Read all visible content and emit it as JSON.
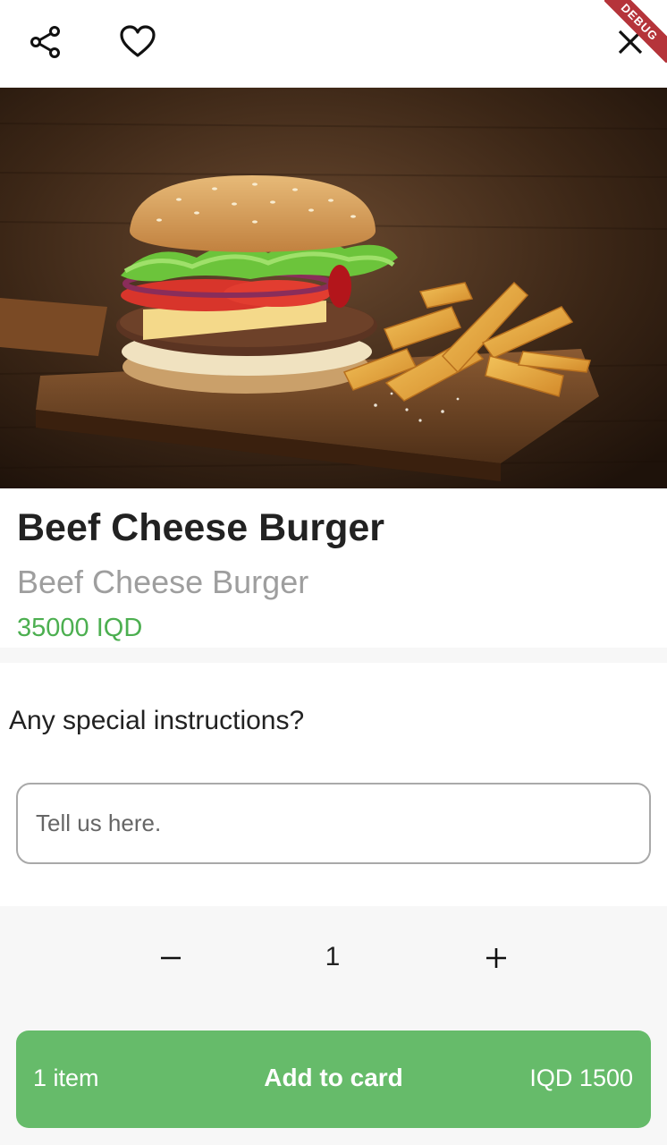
{
  "header": {
    "share_icon": "share-icon",
    "favorite_icon": "heart-icon",
    "close_icon": "close-icon",
    "debug_banner": "DEBUG"
  },
  "product": {
    "image_desc": "burger-and-fries-photo",
    "name": "Beef Cheese Burger",
    "subtitle": "Beef Cheese Burger",
    "price": "35000 IQD"
  },
  "instructions": {
    "label": "Any special instructions?",
    "placeholder": "Tell us here.",
    "value": ""
  },
  "quantity": {
    "minus_icon": "minus-icon",
    "value": "1",
    "plus_icon": "plus-icon"
  },
  "cart_button": {
    "count": "1 item",
    "label": "Add to card",
    "total": "IQD 1500"
  },
  "colors": {
    "accent_green": "#66bb6a",
    "price_green": "#4caf50",
    "debug_red": "#b5343a"
  }
}
